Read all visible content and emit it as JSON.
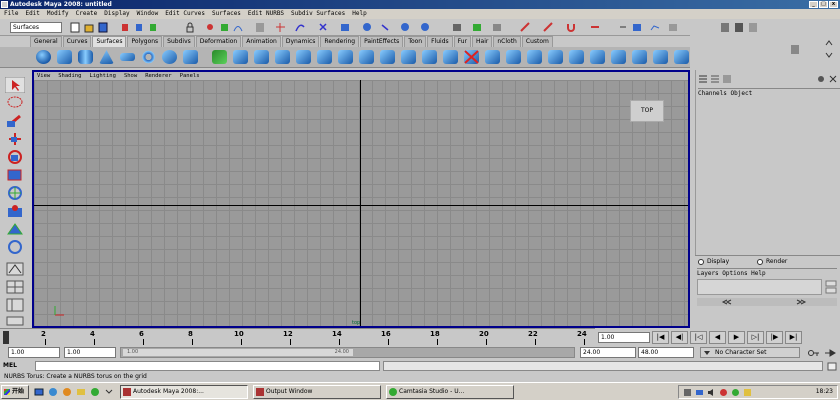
{
  "window": {
    "title": "Autodesk Maya 2008: untitled"
  },
  "menu": [
    "File",
    "Edit",
    "Modify",
    "Create",
    "Display",
    "Window",
    "Edit Curves",
    "Surfaces",
    "Edit NURBS",
    "Subdiv Surfaces",
    "Help"
  ],
  "status_line": {
    "mode": "Surfaces"
  },
  "shelf_tabs": [
    "General",
    "Curves",
    "Surfaces",
    "Polygons",
    "Subdivs",
    "Deformation",
    "Animation",
    "Dynamics",
    "Rendering",
    "PaintEffects",
    "Toon",
    "Fluids",
    "Fur",
    "Hair",
    "nCloth",
    "Custom"
  ],
  "active_shelf_tab": "Surfaces",
  "panel_menu": [
    "View",
    "Shading",
    "Lighting",
    "Show",
    "Renderer",
    "Panels"
  ],
  "viewport": {
    "camera_button": "TOP",
    "camera_label": "top"
  },
  "channel_box": {
    "menu": "Channels  Object"
  },
  "layer_editor": {
    "display_label": "Display",
    "render_label": "Render",
    "menu": "Layers  Options  Help"
  },
  "time_slider": {
    "ticks": [
      "2",
      "4",
      "6",
      "8",
      "10",
      "12",
      "14",
      "16",
      "18",
      "20",
      "22",
      "24"
    ],
    "current_time": "1.00"
  },
  "range_slider": {
    "start": "1.00",
    "playback_start": "1.00",
    "handle_start": "1.00",
    "handle_end": "24.00",
    "playback_end": "24.00",
    "end": "48.00",
    "character_set": "No Character Set"
  },
  "command_line": {
    "label": "MEL"
  },
  "help_line": "NURBS Torus: Create a NURBS torus on the grid",
  "taskbar": {
    "start": "开始",
    "tasks": [
      "Autodesk Maya 2008:...",
      "Output Window",
      "Camtasia Studio - U..."
    ],
    "clock": "18:23"
  }
}
